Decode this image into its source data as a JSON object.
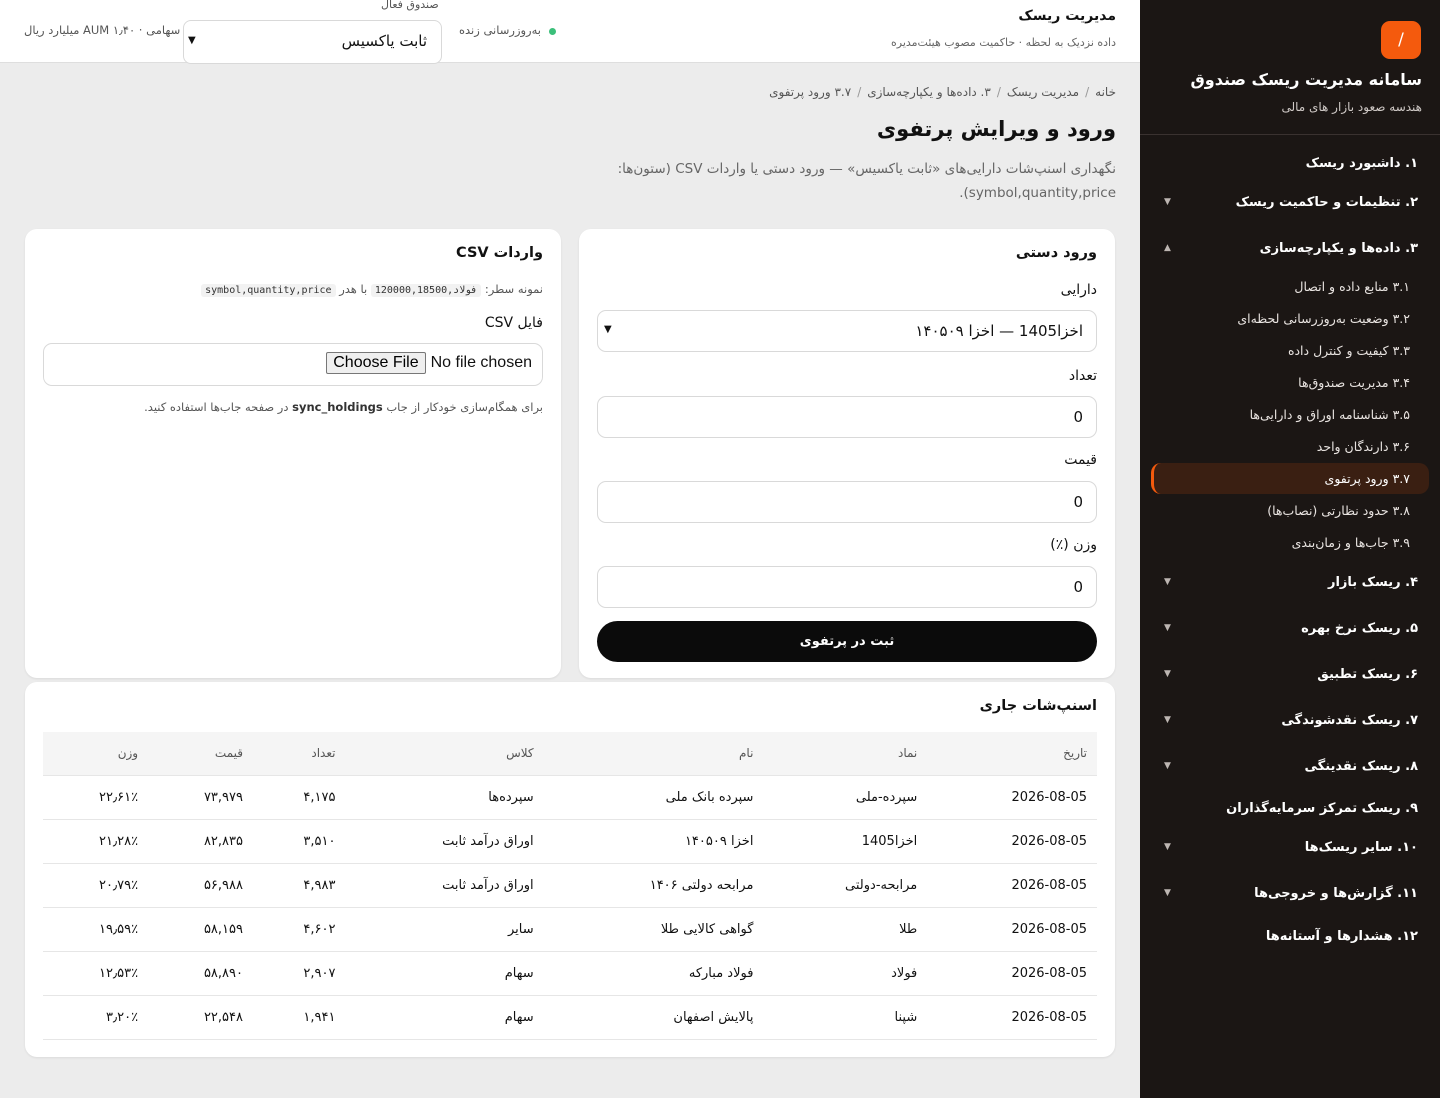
{
  "sidebar": {
    "logo_glyph": "/",
    "title": "سامانه مدیریت ریسک صندوق",
    "subtitle": "هندسه صعود بازار های مالی",
    "items": [
      {
        "label": "۱. داشبورد ریسک",
        "expandable": false
      },
      {
        "label": "۲. تنظیمات و حاکمیت ریسک",
        "expandable": true,
        "expanded": false
      },
      {
        "label": "۳. داده‌ها و یکپارچه‌سازی",
        "expandable": true,
        "expanded": true
      },
      {
        "label": "۴. ریسک بازار",
        "expandable": true,
        "expanded": false
      },
      {
        "label": "۵. ریسک نرخ بهره",
        "expandable": true,
        "expanded": false
      },
      {
        "label": "۶. ریسک تطبیق",
        "expandable": true,
        "expanded": false
      },
      {
        "label": "۷. ریسک نقدشوندگی",
        "expandable": true,
        "expanded": false
      },
      {
        "label": "۸. ریسک نقدینگی",
        "expandable": true,
        "expanded": false
      },
      {
        "label": "۹. ریسک تمرکز سرمایه‌گذاران",
        "expandable": false
      },
      {
        "label": "۱۰. سایر ریسک‌ها",
        "expandable": true,
        "expanded": false
      },
      {
        "label": "۱۱. گزارش‌ها و خروجی‌ها",
        "expandable": true,
        "expanded": false
      },
      {
        "label": "۱۲. هشدارها و آستانه‌ها",
        "expandable": false
      }
    ],
    "subitems": [
      {
        "label": "۳.۱ منابع داده و اتصال"
      },
      {
        "label": "۳.۲ وضعیت به‌روزرسانی لحظه‌ای"
      },
      {
        "label": "۳.۳ کیفیت و کنترل داده"
      },
      {
        "label": "۳.۴ مدیریت صندوق‌ها"
      },
      {
        "label": "۳.۵ شناسنامه اوراق و دارایی‌ها"
      },
      {
        "label": "۳.۶ دارندگان واحد"
      },
      {
        "label": "۳.۷ ورود پرتفوی",
        "active": true
      },
      {
        "label": "۳.۸ حدود نظارتی (نصاب‌ها)"
      },
      {
        "label": "۳.۹ جاب‌ها و زمان‌بندی"
      }
    ],
    "accent_color": "#f45a0d"
  },
  "topbar": {
    "title": "مدیریت ریسک",
    "subtitle": "داده نزدیک به لحظه · حاکمیت مصوب هیئت‌مدیره",
    "live_label": "به‌روزرسانی زنده",
    "live_color": "#3bbf7a",
    "fund_label": "صندوق فعال",
    "fund_value": "ثابت یاکسیس",
    "aum": "سهامی · AUM ۱٫۴۰ میلیارد ریال"
  },
  "breadcrumb": [
    "خانه",
    "مدیریت ریسک",
    "۳. داده‌ها و یکپارچه‌سازی",
    "۳.۷ ورود پرتفوی"
  ],
  "page": {
    "title": "ورود و ویرایش پرتفوی",
    "description": "نگهداری اسنپ‌شات دارایی‌های «ثابت یاکسیس» — ورود دستی یا واردات CSV (ستون‌ها: symbol,quantity,price)."
  },
  "manual": {
    "title": "ورود دستی",
    "asset_label": "دارایی",
    "asset_value": "اخزا1405 — اخزا ۱۴۰۵۰۹",
    "qty_label": "تعداد",
    "qty_value": "0",
    "price_label": "قیمت",
    "price_value": "0",
    "weight_label": "وزن (٪)",
    "weight_value": "0",
    "submit_label": "ثبت در پرتفوی"
  },
  "csv": {
    "title": "واردات CSV",
    "sample_prefix": "نمونه سطر:",
    "sample_row": "فولاد,120000,18500",
    "sample_mid": "با هدر",
    "sample_header": "symbol,quantity,price",
    "file_label": "فایل CSV",
    "file_button": "Choose File",
    "file_status": "No file chosen",
    "note_prefix": "برای همگام‌سازی خودکار از جاب",
    "note_job": "sync_holdings",
    "note_suffix": "در صفحه جاب‌ها استفاده کنید."
  },
  "snapshot": {
    "title": "اسنپ‌شات جاری",
    "columns": [
      "تاریخ",
      "نماد",
      "نام",
      "کلاس",
      "تعداد",
      "قیمت",
      "وزن"
    ],
    "rows": [
      [
        "2026-08-05",
        "سپرده-ملی",
        "سپرده بانک ملی",
        "سپرده‌ها",
        "۴,۱۷۵",
        "۷۳,۹۷۹",
        "۲۲٫۶۱٪"
      ],
      [
        "2026-08-05",
        "اخزا1405",
        "اخزا ۱۴۰۵۰۹",
        "اوراق درآمد ثابت",
        "۳,۵۱۰",
        "۸۲,۸۳۵",
        "۲۱٫۲۸٪"
      ],
      [
        "2026-08-05",
        "مرابحه-دولتی",
        "مرابحه دولتی ۱۴۰۶",
        "اوراق درآمد ثابت",
        "۴,۹۸۳",
        "۵۶,۹۸۸",
        "۲۰٫۷۹٪"
      ],
      [
        "2026-08-05",
        "طلا",
        "گواهی کالایی طلا",
        "سایر",
        "۴,۶۰۲",
        "۵۸,۱۵۹",
        "۱۹٫۵۹٪"
      ],
      [
        "2026-08-05",
        "فولاد",
        "فولاد مبارکه",
        "سهام",
        "۲,۹۰۷",
        "۵۸,۸۹۰",
        "۱۲٫۵۳٪"
      ],
      [
        "2026-08-05",
        "شپنا",
        "پالایش اصفهان",
        "سهام",
        "۱,۹۴۱",
        "۲۲,۵۴۸",
        "۳٫۲۰٪"
      ]
    ]
  }
}
